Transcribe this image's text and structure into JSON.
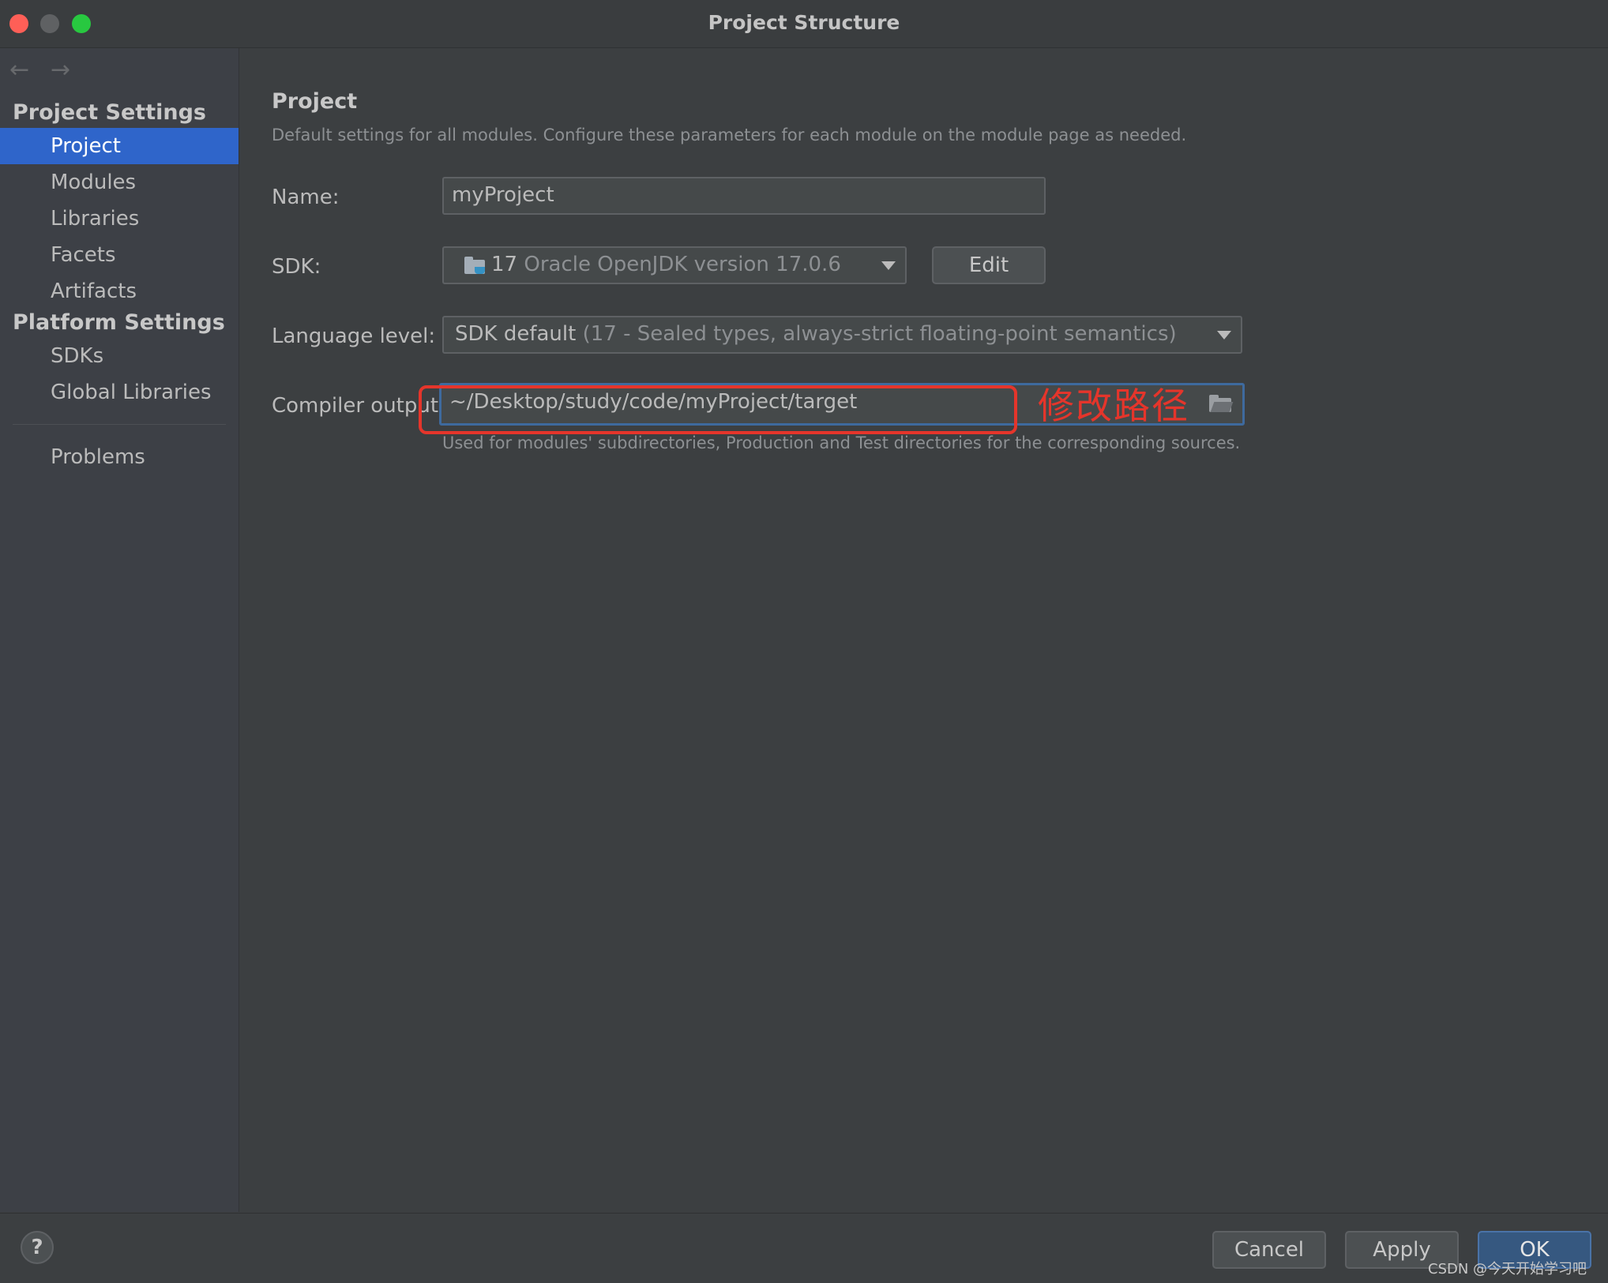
{
  "window": {
    "title": "Project Structure"
  },
  "sidebar": {
    "groups": [
      {
        "label": "Project Settings",
        "items": [
          "Project",
          "Modules",
          "Libraries",
          "Facets",
          "Artifacts"
        ]
      },
      {
        "label": "Platform Settings",
        "items": [
          "SDKs",
          "Global Libraries"
        ]
      }
    ],
    "problems": "Problems",
    "selected": "Project"
  },
  "main": {
    "title": "Project",
    "description": "Default settings for all modules. Configure these parameters for each module on the module page as needed.",
    "name": {
      "label": "Name:",
      "value": "myProject"
    },
    "sdk": {
      "label": "SDK:",
      "version": "17",
      "detail": "Oracle OpenJDK version 17.0.6",
      "edit_label": "Edit"
    },
    "language_level": {
      "label": "Language level:",
      "value": "SDK default",
      "detail": "(17 - Sealed types, always-strict floating-point semantics)"
    },
    "compiler_output": {
      "label": "Compiler output:",
      "value": "~/Desktop/study/code/myProject/target",
      "hint": "Used for modules' subdirectories, Production and Test directories for the corresponding sources."
    },
    "annotation": "修改路径"
  },
  "footer": {
    "help": "?",
    "cancel": "Cancel",
    "apply": "Apply",
    "ok": "OK",
    "watermark": "CSDN @今天开始学习吧"
  },
  "colors": {
    "selection": "#2f65ca",
    "annotation": "#e5352b",
    "focus_border": "#3e6a9e"
  },
  "icons": [
    "back-arrow-icon",
    "forward-arrow-icon",
    "sdk-folder-icon",
    "dropdown-arrow-icon",
    "folder-open-icon",
    "help-icon"
  ]
}
